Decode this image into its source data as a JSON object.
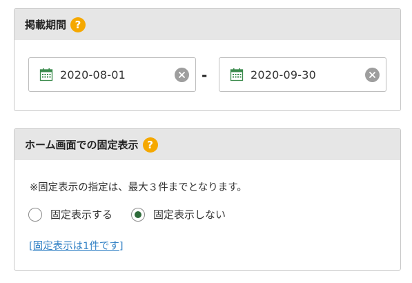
{
  "period": {
    "title": "掲載期間",
    "help_icon": "?",
    "start_date": "2020-08-01",
    "end_date": "2020-09-30",
    "separator": "-"
  },
  "pin": {
    "title": "ホーム画面での固定表示",
    "help_icon": "?",
    "notice": "※固定表示の指定は、最大３件までとなります。",
    "options": [
      {
        "label": "固定表示する",
        "selected": false
      },
      {
        "label": "固定表示しない",
        "selected": true
      }
    ],
    "link_text": "[固定表示は1件です]"
  },
  "colors": {
    "accent_help": "#f5a800",
    "radio_selected": "#2e6b3a",
    "link": "#2e7fc4",
    "calendar_icon": "#3a8a4c"
  },
  "icons": [
    "help-icon",
    "calendar-icon",
    "clear-icon"
  ]
}
